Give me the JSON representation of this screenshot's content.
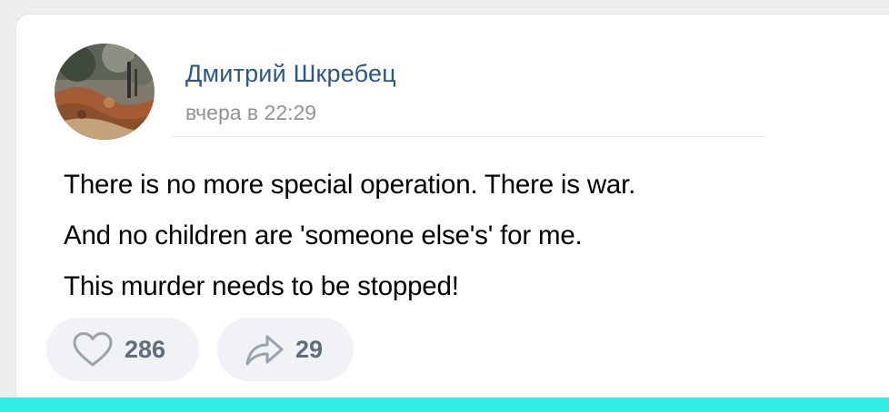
{
  "post": {
    "author_name": "Дмитрий Шкребец",
    "timestamp": "вчера в 22:29",
    "avatar_icon": "nature-photo-avatar",
    "lines": [
      "There is no more special operation. There is war.",
      "And no children are 'someone else's' for me.",
      "This murder needs to be stopped!"
    ]
  },
  "actions": {
    "likes": {
      "icon": "heart-icon",
      "count": "286"
    },
    "shares": {
      "icon": "share-arrow-icon",
      "count": "29"
    }
  },
  "colors": {
    "author_link": "#2a5885",
    "secondary_text": "#939393",
    "action_bg": "#f0f2f5",
    "action_text": "#626d7a",
    "bottom_bar": "#2ff0e6"
  }
}
